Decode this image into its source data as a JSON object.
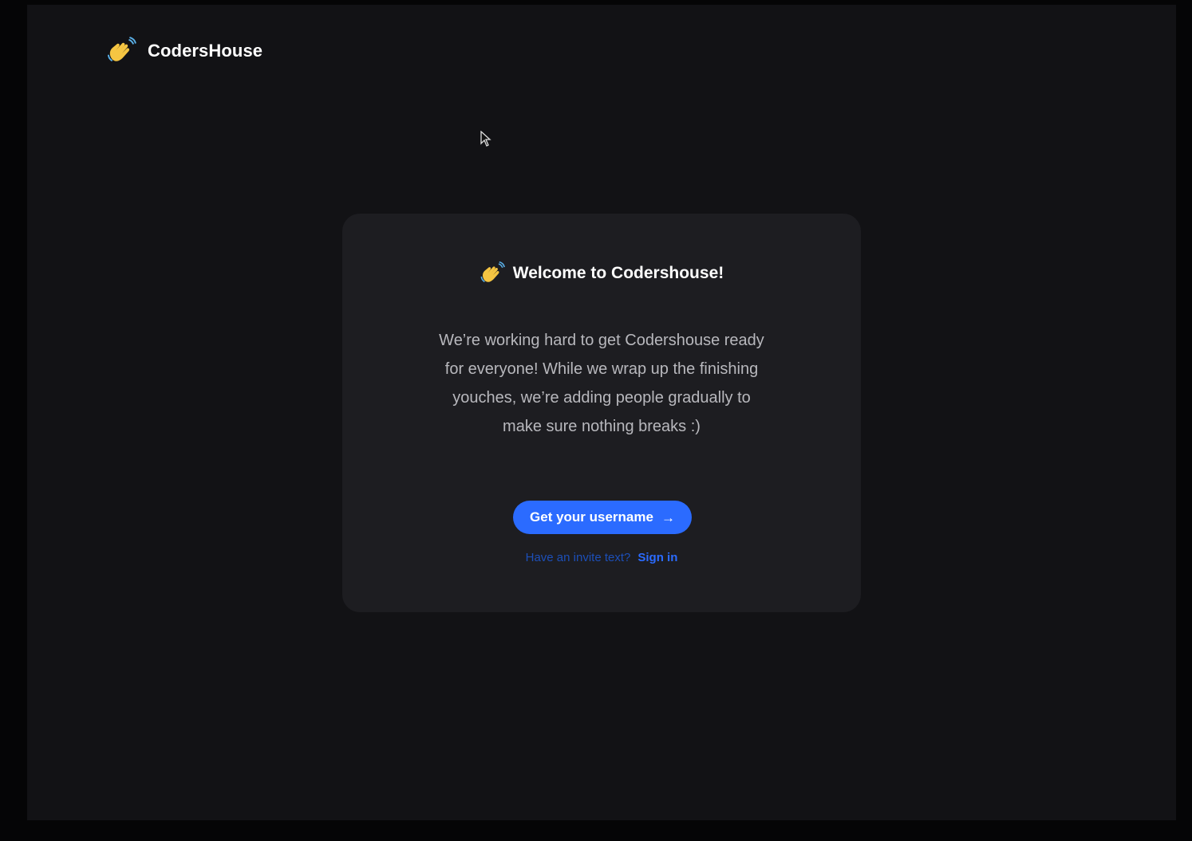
{
  "header": {
    "brand": "CodersHouse",
    "logo_icon": "waving-hand-icon"
  },
  "card": {
    "title_icon": "waving-hand-icon",
    "title": "Welcome to Codershouse!",
    "body": "We’re working hard to get Codershouse ready for everyone! While we wrap up the finishing youches, we’re adding people gradually to make sure nothing breaks :)",
    "cta_label": "Get your username",
    "cta_icon": "arrow-right-icon",
    "invite_text": "Have an invite text?",
    "sign_in_label": "Sign in"
  },
  "colors": {
    "background": "#121215",
    "card": "#1d1d21",
    "accent": "#2b6bff",
    "text": "#ffffff",
    "muted_text": "#b8b8bd"
  }
}
